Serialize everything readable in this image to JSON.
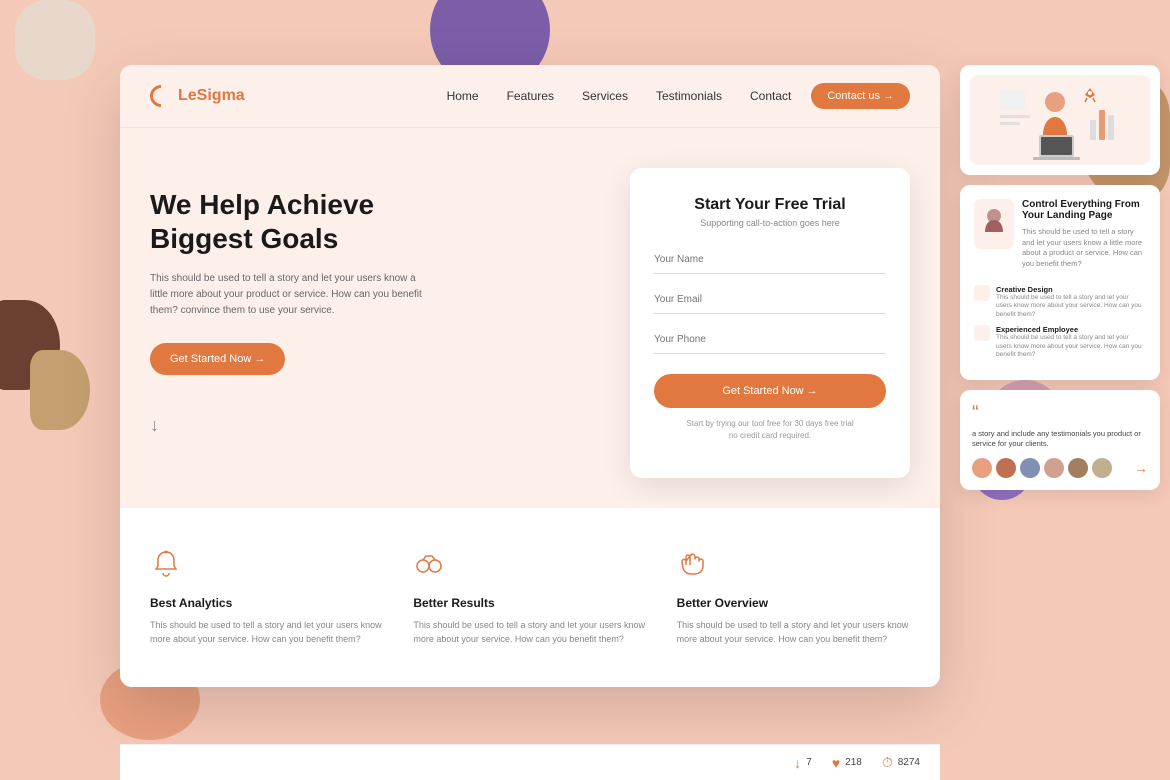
{
  "background": "#f5c9b8",
  "brand": {
    "name": "LeSigma",
    "color": "#e07840"
  },
  "navbar": {
    "links": [
      "Home",
      "Features",
      "Services",
      "Testimonials",
      "Contact"
    ],
    "cta_label": "Contact us →"
  },
  "hero": {
    "title_line1": "We Help Achieve",
    "title_line2": "Biggest Goals",
    "description": "This should be used to tell a story and let your users know a little more about your product or service. How can you benefit them? convince them to use your service.",
    "cta_label": "Get Started Now →",
    "arrow": "↓"
  },
  "trial_card": {
    "title": "Start Your Free Trial",
    "subtitle": "Supporting call-to-action goes here",
    "name_placeholder": "Your Name",
    "email_placeholder": "Your Email",
    "phone_placeholder": "Your Phone",
    "submit_label": "Get Started Now →",
    "note_line1": "Start by trying our tool free for 30 days free trial",
    "note_line2": "no credit card required."
  },
  "features": [
    {
      "icon": "bell",
      "title": "Best Analytics",
      "description": "This should be used to tell a story and let your users know more about your service. How can you benefit them?"
    },
    {
      "icon": "binoculars",
      "title": "Better Results",
      "description": "This should be used to tell a story and let your users know more about your service. How can you benefit them?"
    },
    {
      "icon": "hand",
      "title": "Better Overview",
      "description": "This should be used to tell a story and let your users know more about your service. How can you benefit them?"
    }
  ],
  "right_panel1": {
    "has_illustration": true
  },
  "right_panel2": {
    "title": "Control Everything From Your Landing Page",
    "description": "This should be used to tell a story and let your users know a little more about a product or service. How can you benefit them?",
    "features": [
      {
        "title": "Creative Design",
        "description": "This should be used to tell a story and let your users know more about your service. How can you benefit them?"
      },
      {
        "title": "Experienced Employee",
        "description": "This should be used to tell a story and let your users know more about your service. How can you benefit them?"
      }
    ]
  },
  "right_panel3": {
    "quote_icon": "“",
    "text": "a story and include any testimonials you product or service for your clients.",
    "arrow": "→",
    "avatars": [
      "#e8a080",
      "#c07050",
      "#8090b0",
      "#d0a090",
      "#a08060",
      "#c0b090"
    ]
  },
  "stats": [
    {
      "icon": "↓",
      "value": "7"
    },
    {
      "icon": "♡",
      "value": "218"
    },
    {
      "icon": "⏱",
      "value": "8274"
    }
  ]
}
